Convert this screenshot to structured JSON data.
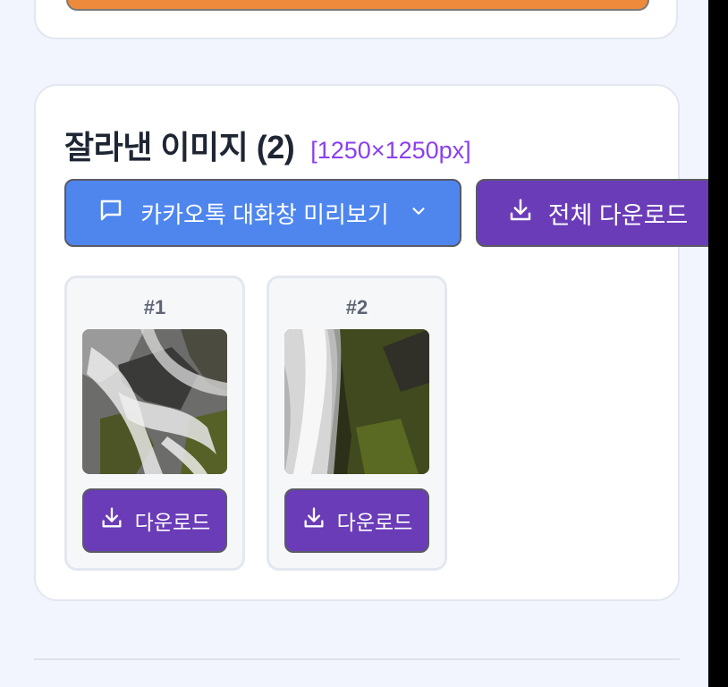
{
  "section": {
    "title": "잘라낸 이미지 (2)",
    "dimensions": "[1250×1250px]"
  },
  "toolbar": {
    "preview_label": "카카오톡 대화창 미리보기",
    "download_all_label": "전체 다운로드"
  },
  "images": [
    {
      "number": "#1",
      "download_label": "다운로드"
    },
    {
      "number": "#2",
      "download_label": "다운로드"
    }
  ],
  "colors": {
    "accent_orange": "#ed8a3c",
    "preview_blue": "#4e86ee",
    "download_purple": "#6a3cb8",
    "dimension_text": "#8a3ff0"
  },
  "icons": {
    "preview": "chat-bubble-icon",
    "dropdown": "chevron-down-icon",
    "download": "download-icon"
  }
}
